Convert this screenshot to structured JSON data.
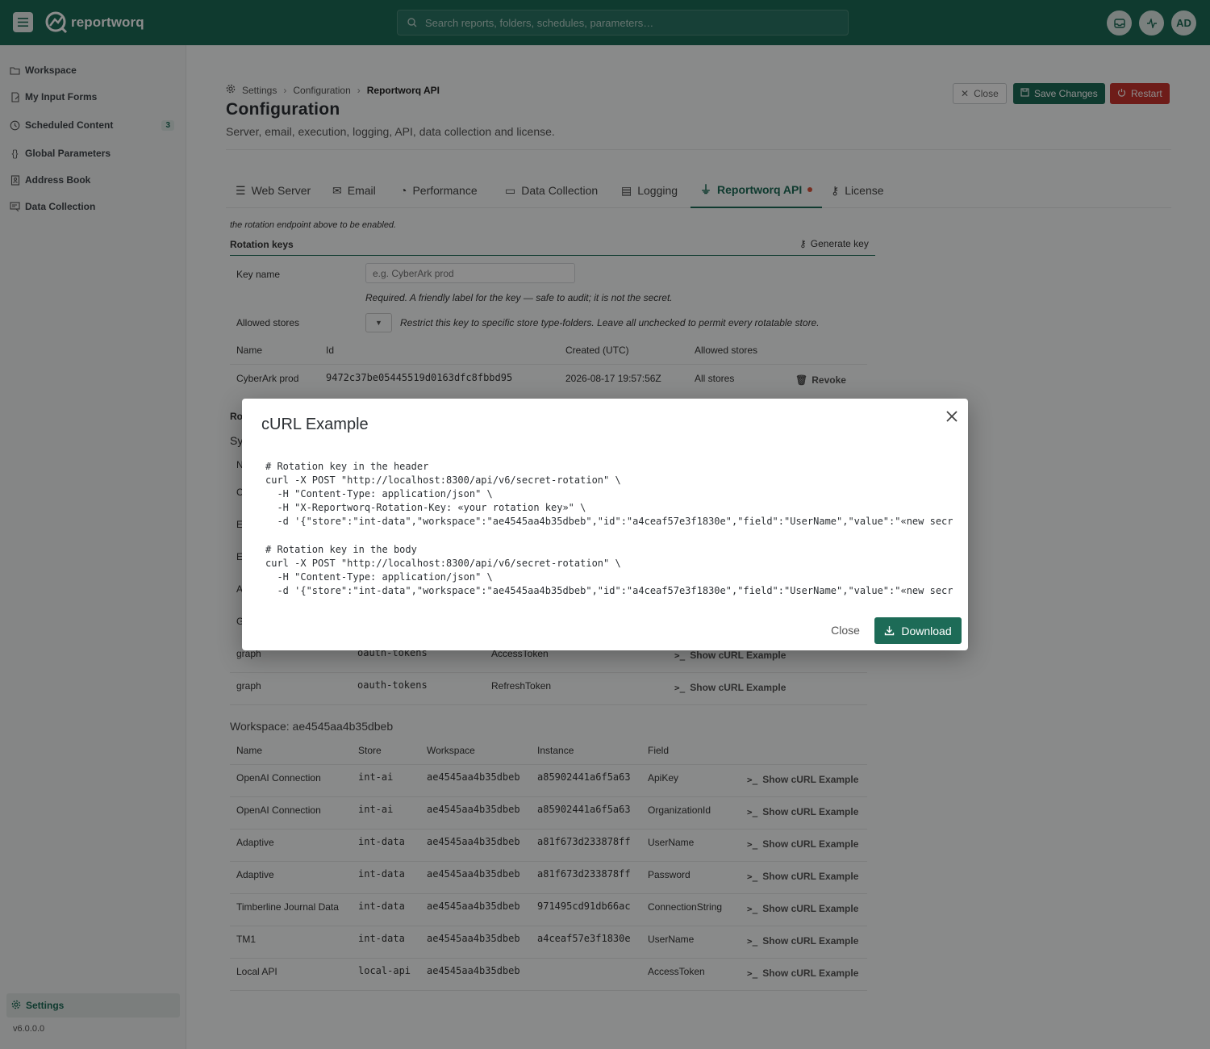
{
  "app": {
    "brand": "reportworq",
    "search_placeholder": "Search reports, folders, schedules, parameters…",
    "avatar": "AD"
  },
  "sidebar": {
    "items": [
      {
        "label": "Workspace",
        "icon": "folder-icon"
      },
      {
        "label": "My Input Forms",
        "icon": "form-icon"
      },
      {
        "label": "Scheduled Content",
        "icon": "clock-icon",
        "badge": "3"
      },
      {
        "label": "Global Parameters",
        "icon": "braces-icon"
      },
      {
        "label": "Address Book",
        "icon": "book-icon"
      },
      {
        "label": "Data Collection",
        "icon": "data-collection-icon"
      }
    ],
    "settings_label": "Settings",
    "version": "v6.0.0.0"
  },
  "breadcrumb": {
    "a": "Settings",
    "b": "Configuration",
    "c": "Reportworq API"
  },
  "page": {
    "title": "Configuration",
    "subtitle": "Server, email, execution, logging, API, data collection and license."
  },
  "header_buttons": {
    "close": "Close",
    "save": "Save Changes",
    "restart": "Restart"
  },
  "tabs": [
    "Web Server",
    "Email",
    "Performance",
    "Data Collection",
    "Logging",
    "Reportworq API",
    "License"
  ],
  "active_tab": "Reportworq API",
  "rotation": {
    "cut_text": "the rotation endpoint above to be enabled.",
    "section_title": "Rotation keys",
    "generate_label": "Generate key",
    "key_name_label": "Key name",
    "key_name_placeholder": "e.g. CyberArk prod",
    "key_name_help": "Required. A friendly label for the key — safe to audit; it is not the secret.",
    "allowed_stores_label": "Allowed stores",
    "allowed_stores_help": "Restrict this key to specific store type-folders. Leave all unchecked to permit every rotatable store.",
    "columns": [
      "Name",
      "Id",
      "Created (UTC)",
      "Allowed stores"
    ],
    "row": {
      "name": "CyberArk prod",
      "id": "9472c37be05445519d0163dfc8fbbd95",
      "created": "2026-08-17 19:57:56Z",
      "stores": "All stores",
      "revoke": "Revoke"
    }
  },
  "hidden_partials": {
    "ro": "Ro",
    "sy": "Sy",
    "n": "N",
    "c": "C",
    "e1": "E",
    "e2": "E",
    "a": "A",
    "g": "G"
  },
  "system_rows": [
    {
      "name": "graph",
      "store": "oauth-tokens",
      "field": "AccessToken",
      "action": "Show cURL Example"
    },
    {
      "name": "graph",
      "store": "oauth-tokens",
      "field": "RefreshToken",
      "action": "Show cURL Example"
    }
  ],
  "workspace": {
    "title": "Workspace: ae4545aa4b35dbeb",
    "columns": [
      "Name",
      "Store",
      "Workspace",
      "Instance",
      "Field"
    ],
    "rows": [
      {
        "name": "OpenAI Connection",
        "store": "int-ai",
        "workspace": "ae4545aa4b35dbeb",
        "instance": "a85902441a6f5a63",
        "field": "ApiKey",
        "action": "Show cURL Example"
      },
      {
        "name": "OpenAI Connection",
        "store": "int-ai",
        "workspace": "ae4545aa4b35dbeb",
        "instance": "a85902441a6f5a63",
        "field": "OrganizationId",
        "action": "Show cURL Example"
      },
      {
        "name": "Adaptive",
        "store": "int-data",
        "workspace": "ae4545aa4b35dbeb",
        "instance": "a81f673d233878ff",
        "field": "UserName",
        "action": "Show cURL Example"
      },
      {
        "name": "Adaptive",
        "store": "int-data",
        "workspace": "ae4545aa4b35dbeb",
        "instance": "a81f673d233878ff",
        "field": "Password",
        "action": "Show cURL Example"
      },
      {
        "name": "Timberline Journal Data",
        "store": "int-data",
        "workspace": "ae4545aa4b35dbeb",
        "instance": "971495cd91db66ac",
        "field": "ConnectionString",
        "action": "Show cURL Example"
      },
      {
        "name": "TM1",
        "store": "int-data",
        "workspace": "ae4545aa4b35dbeb",
        "instance": "a4ceaf57e3f1830e",
        "field": "UserName",
        "action": "Show cURL Example"
      },
      {
        "name": "Local API",
        "store": "local-api",
        "workspace": "ae4545aa4b35dbeb",
        "instance": "",
        "field": "AccessToken",
        "action": "Show cURL Example"
      }
    ]
  },
  "modal": {
    "title": "cURL Example",
    "code": "# Rotation key in the header\ncurl -X POST \"http://localhost:8300/api/v6/secret-rotation\" \\\n  -H \"Content-Type: application/json\" \\\n  -H \"X-Reportworq-Rotation-Key: «your rotation key»\" \\\n  -d '{\"store\":\"int-data\",\"workspace\":\"ae4545aa4b35dbeb\",\"id\":\"a4ceaf57e3f1830e\",\"field\":\"UserName\",\"value\":\"«new secr\n\n# Rotation key in the body\ncurl -X POST \"http://localhost:8300/api/v6/secret-rotation\" \\\n  -H \"Content-Type: application/json\" \\\n  -d '{\"store\":\"int-data\",\"workspace\":\"ae4545aa4b35dbeb\",\"id\":\"a4ceaf57e3f1830e\",\"field\":\"UserName\",\"value\":\"«new secr",
    "close_label": "Close",
    "download_label": "Download"
  },
  "colors": {
    "brand": "#1d6b57",
    "danger": "#c9342e",
    "dot": "#d9553d"
  }
}
